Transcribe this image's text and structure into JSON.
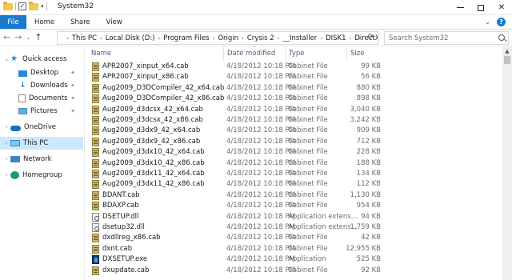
{
  "window": {
    "title": "System32",
    "min_label": "",
    "close_label": "✕"
  },
  "ribbon": {
    "tabs": [
      "File",
      "Home",
      "Share",
      "View"
    ]
  },
  "address": {
    "breadcrumbs": [
      "This PC",
      "Local Disk (D:)",
      "Program Files",
      "Origin",
      "Crysis 2",
      "__Installer",
      "DISK1",
      "DirectX"
    ],
    "search_placeholder": "Search System32"
  },
  "nav_pane": {
    "items": [
      {
        "label": "Quick access",
        "icon": "star-icon"
      },
      {
        "label": "Desktop",
        "icon": "desktop-icon"
      },
      {
        "label": "Downloads",
        "icon": "downloads-icon"
      },
      {
        "label": "Documents",
        "icon": "documents-icon"
      },
      {
        "label": "Pictures",
        "icon": "pictures-icon"
      },
      {
        "label": "OneDrive",
        "icon": "onedrive-icon"
      },
      {
        "label": "This PC",
        "icon": "this-pc-icon"
      },
      {
        "label": "Network",
        "icon": "network-icon"
      },
      {
        "label": "Homegroup",
        "icon": "homegroup-icon"
      }
    ]
  },
  "columns": {
    "name": "Name",
    "date": "Date modified",
    "type": "Type",
    "size": "Size"
  },
  "files": [
    {
      "name": "APR2007_xinput_x64.cab",
      "date": "4/18/2012 10:18 PM",
      "type": "Cabinet File",
      "size": "99 KB",
      "icon": "cab"
    },
    {
      "name": "APR2007_xinput_x86.cab",
      "date": "4/18/2012 10:18 PM",
      "type": "Cabinet File",
      "size": "56 KB",
      "icon": "cab"
    },
    {
      "name": "Aug2009_D3DCompiler_42_x64.cab",
      "date": "4/18/2012 10:18 PM",
      "type": "Cabinet File",
      "size": "880 KB",
      "icon": "cab"
    },
    {
      "name": "Aug2009_D3DCompiler_42_x86.cab",
      "date": "4/18/2012 10:18 PM",
      "type": "Cabinet File",
      "size": "898 KB",
      "icon": "cab"
    },
    {
      "name": "Aug2009_d3dcsx_42_x64.cab",
      "date": "4/18/2012 10:18 PM",
      "type": "Cabinet File",
      "size": "3,040 KB",
      "icon": "cab"
    },
    {
      "name": "Aug2009_d3dcsx_42_x86.cab",
      "date": "4/18/2012 10:18 PM",
      "type": "Cabinet File",
      "size": "3,242 KB",
      "icon": "cab"
    },
    {
      "name": "Aug2009_d3dx9_42_x64.cab",
      "date": "4/18/2012 10:18 PM",
      "type": "Cabinet File",
      "size": "909 KB",
      "icon": "cab"
    },
    {
      "name": "Aug2009_d3dx9_42_x86.cab",
      "date": "4/18/2012 10:18 PM",
      "type": "Cabinet File",
      "size": "712 KB",
      "icon": "cab"
    },
    {
      "name": "Aug2009_d3dx10_42_x64.cab",
      "date": "4/18/2012 10:18 PM",
      "type": "Cabinet File",
      "size": "228 KB",
      "icon": "cab"
    },
    {
      "name": "Aug2009_d3dx10_42_x86.cab",
      "date": "4/18/2012 10:18 PM",
      "type": "Cabinet File",
      "size": "188 KB",
      "icon": "cab"
    },
    {
      "name": "Aug2009_d3dx11_42_x64.cab",
      "date": "4/18/2012 10:18 PM",
      "type": "Cabinet File",
      "size": "134 KB",
      "icon": "cab"
    },
    {
      "name": "Aug2009_d3dx11_42_x86.cab",
      "date": "4/18/2012 10:18 PM",
      "type": "Cabinet File",
      "size": "112 KB",
      "icon": "cab"
    },
    {
      "name": "BDANT.cab",
      "date": "4/18/2012 10:18 PM",
      "type": "Cabinet File",
      "size": "1,130 KB",
      "icon": "cab"
    },
    {
      "name": "BDAXP.cab",
      "date": "4/18/2012 10:18 PM",
      "type": "Cabinet File",
      "size": "954 KB",
      "icon": "cab"
    },
    {
      "name": "DSETUP.dll",
      "date": "4/18/2012 10:18 PM",
      "type": "Application extens...",
      "size": "94 KB",
      "icon": "dll"
    },
    {
      "name": "dsetup32.dll",
      "date": "4/18/2012 10:18 PM",
      "type": "Application extens...",
      "size": "1,759 KB",
      "icon": "dll"
    },
    {
      "name": "dxdllreg_x86.cab",
      "date": "4/18/2012 10:18 PM",
      "type": "Cabinet File",
      "size": "42 KB",
      "icon": "cab"
    },
    {
      "name": "dxnt.cab",
      "date": "4/18/2012 10:18 PM",
      "type": "Cabinet File",
      "size": "12,955 KB",
      "icon": "cab"
    },
    {
      "name": "DXSETUP.exe",
      "date": "4/18/2012 10:18 PM",
      "type": "Application",
      "size": "525 KB",
      "icon": "exe"
    },
    {
      "name": "dxupdate.cab",
      "date": "4/18/2012 10:18 PM",
      "type": "Cabinet File",
      "size": "92 KB",
      "icon": "cab"
    }
  ]
}
